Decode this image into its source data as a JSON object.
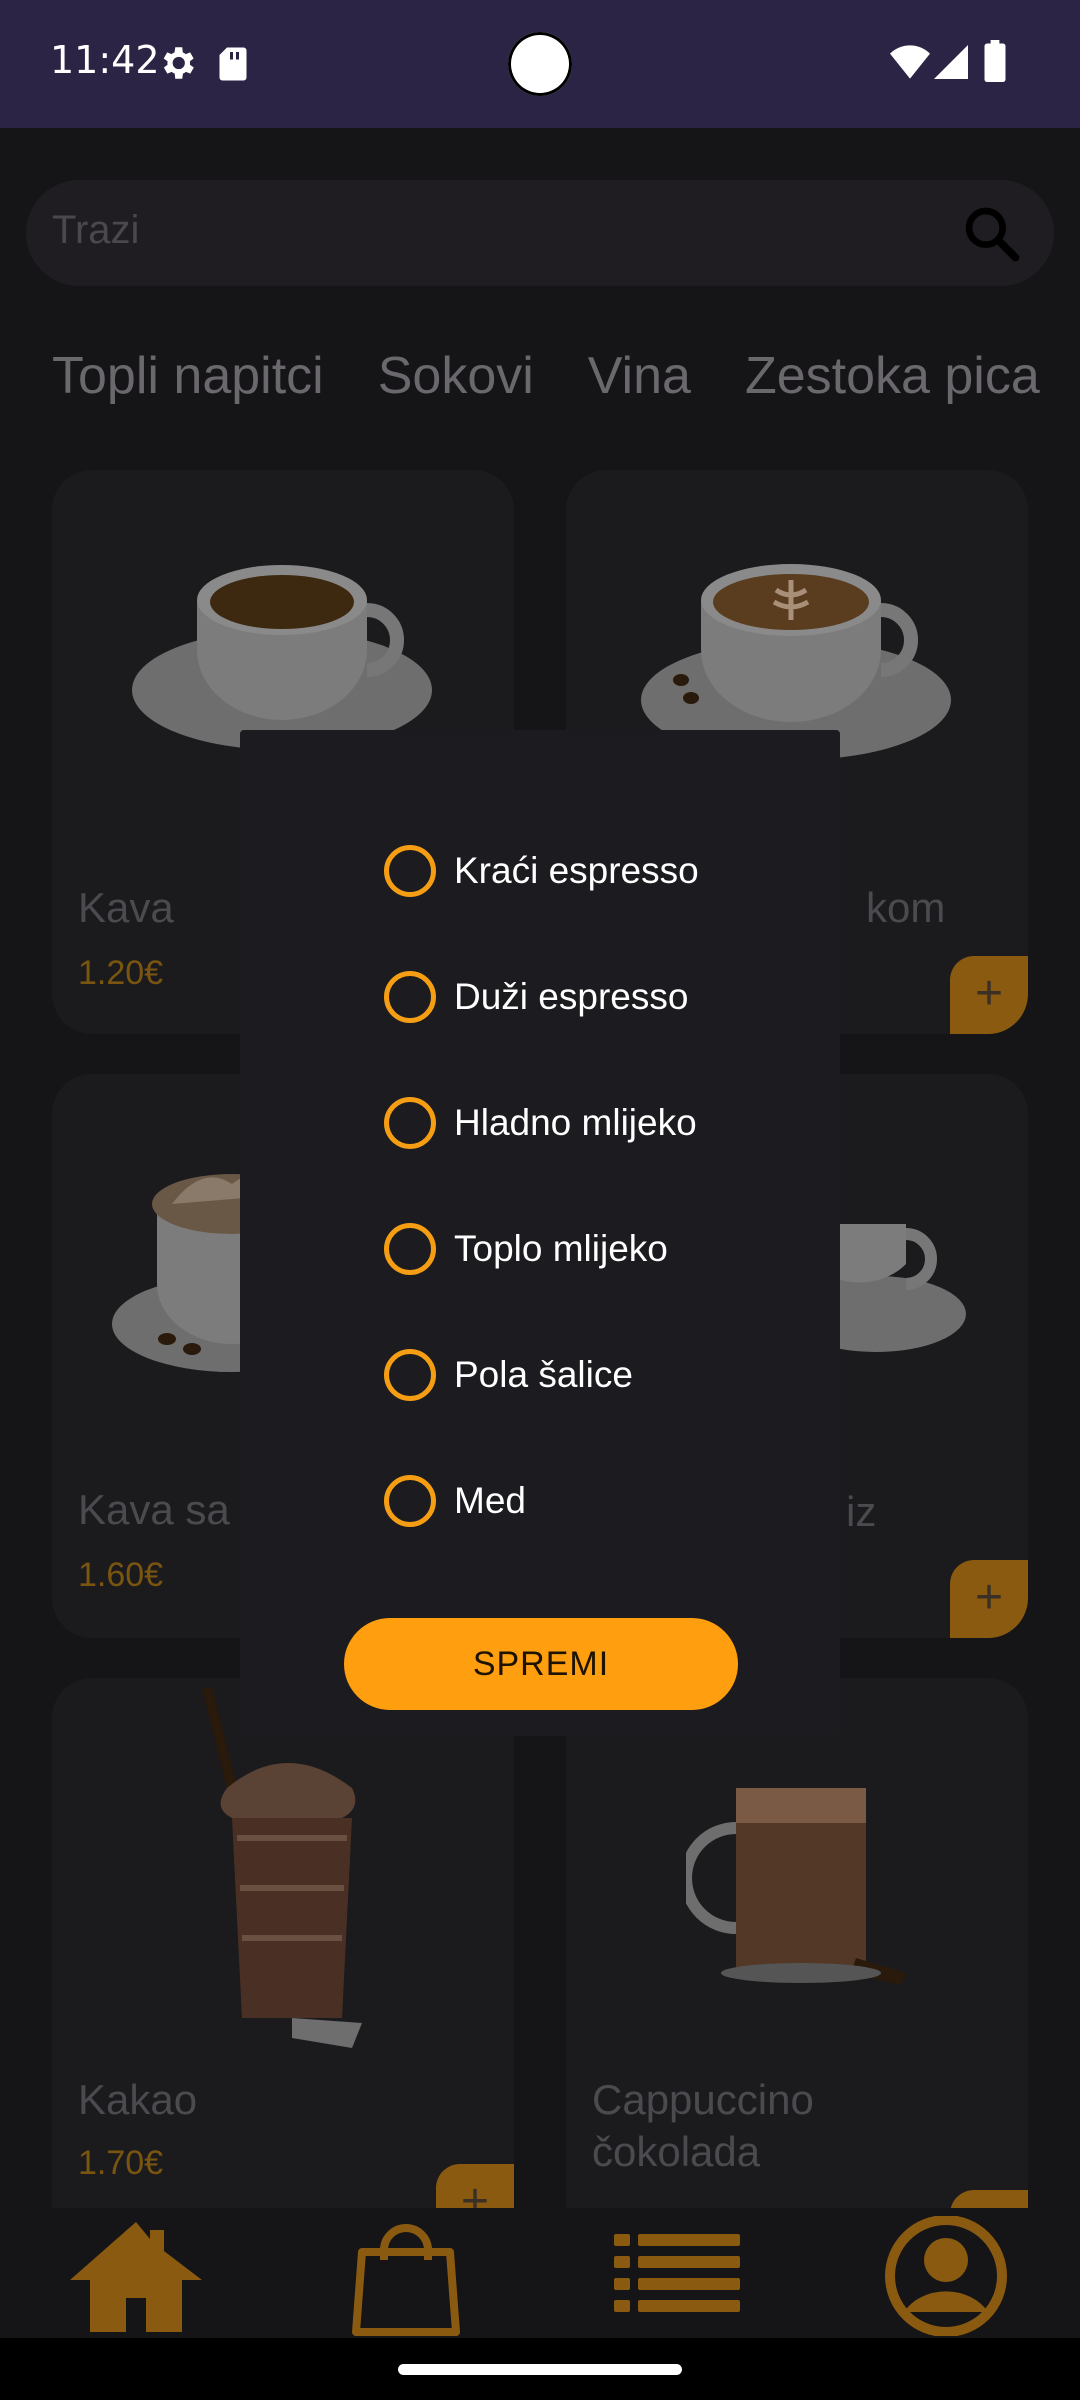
{
  "status_bar": {
    "time": "11:42",
    "icons": [
      "settings-gear-icon",
      "sd-card-icon",
      "camera-cutout",
      "wifi-icon",
      "signal-icon",
      "battery-icon"
    ]
  },
  "search": {
    "placeholder": "Trazi",
    "icon": "search-icon"
  },
  "categories": [
    "Topli napitci",
    "Sokovi",
    "Vina",
    "Zestoka pica"
  ],
  "products": [
    {
      "name": "Kava",
      "price": "1.20€"
    },
    {
      "name": "kom",
      "price": ""
    },
    {
      "name": "Kava sa",
      "price": "1.60€"
    },
    {
      "name": "iz",
      "price": ""
    },
    {
      "name": "Kakao",
      "price": "1.70€"
    },
    {
      "name": "Cappuccino čokolada",
      "price": ""
    }
  ],
  "add_label": "+",
  "dialog": {
    "options": [
      {
        "label": "Kraći espresso",
        "checked": false
      },
      {
        "label": "Duži espresso",
        "checked": false
      },
      {
        "label": "Hladno mlijeko",
        "checked": false
      },
      {
        "label": "Toplo mlijeko",
        "checked": false
      },
      {
        "label": "Pola šalice",
        "checked": false
      },
      {
        "label": "Med",
        "checked": false
      }
    ],
    "save_label": "SPREMI"
  },
  "bottom_nav": [
    "home-icon",
    "shopping-bag-icon",
    "list-icon",
    "account-icon"
  ],
  "colors": {
    "accent": "#ff9e0e",
    "status_bar": "#2c2444",
    "background": "#151417",
    "dialog": "#1c1b1f"
  }
}
